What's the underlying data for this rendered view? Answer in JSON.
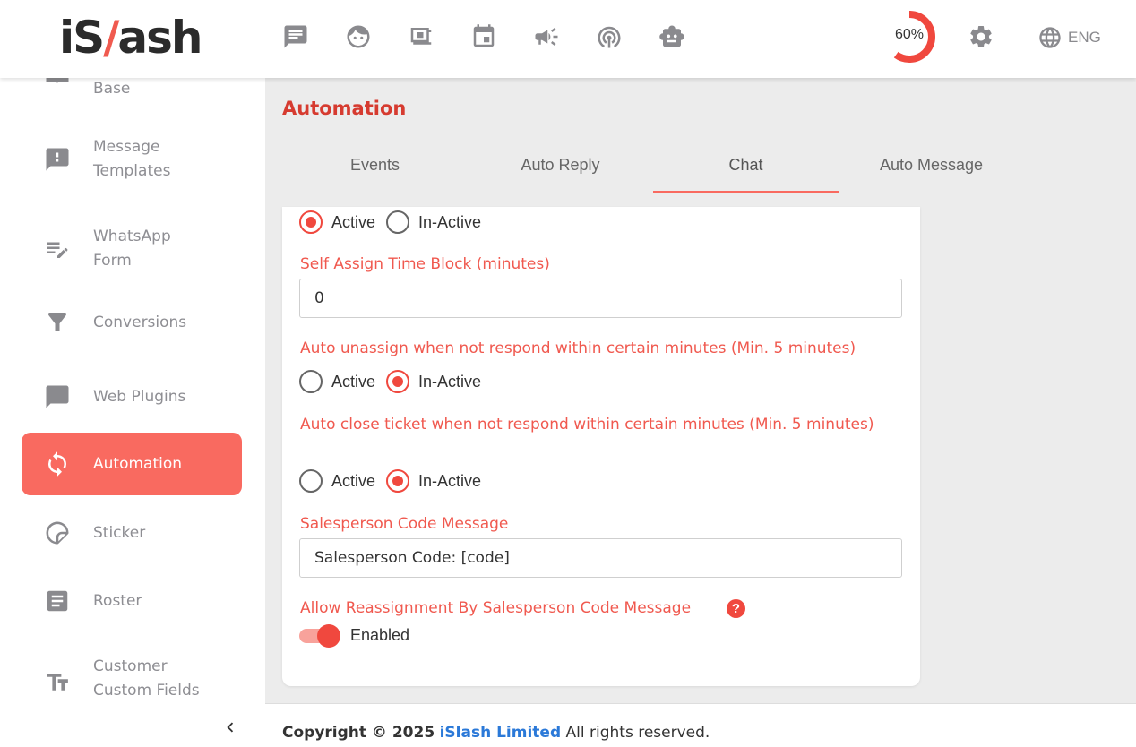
{
  "logo": {
    "text_left": "iS",
    "text_slash": "/",
    "text_right": "ash"
  },
  "topnav": {
    "icons": [
      "chat-icon",
      "face-icon",
      "video-icon",
      "calendar-icon",
      "megaphone-icon",
      "podcast-icon",
      "robot-icon"
    ],
    "progress": {
      "label": "60%",
      "value": 60,
      "color": "#f0483e"
    },
    "settings_icon": "gear-icon",
    "language": "ENG"
  },
  "sidebar": {
    "items": [
      {
        "label": "Base",
        "icon": "book-icon"
      },
      {
        "label": "Message\nTemplates",
        "icon": "alert-message-icon"
      },
      {
        "label": "WhatsApp\nForm",
        "icon": "form-edit-icon"
      },
      {
        "label": "Conversions",
        "icon": "funnel-icon"
      },
      {
        "label": "Web Plugins",
        "icon": "message-bubble-icon"
      },
      {
        "label": "Automation",
        "icon": "refresh-icon",
        "active": true
      },
      {
        "label": "Sticker",
        "icon": "sticker-icon"
      },
      {
        "label": "Roster",
        "icon": "list-icon"
      },
      {
        "label": "Customer\nCustom Fields",
        "icon": "text-fields-icon"
      }
    ]
  },
  "main": {
    "title": "Automation",
    "tabs": [
      {
        "label": "Events"
      },
      {
        "label": "Auto Reply"
      },
      {
        "label": "Chat",
        "active": true
      },
      {
        "label": "Auto Message"
      }
    ],
    "form": {
      "radio_active": "Active",
      "radio_inactive": "In-Active",
      "self_assign_label": "Self Assign Time Block (minutes)",
      "self_assign_value": "0",
      "auto_unassign_label": "Auto unassign when not respond within certain minutes (Min. 5 minutes)",
      "auto_close_label": "Auto close ticket when not respond within certain minutes (Min. 5 minutes)",
      "sales_code_label": "Salesperson Code Message",
      "sales_code_value": "Salesperson Code: [code]",
      "reassign_label": "Allow Reassignment By Salesperson Code Message",
      "help": "?",
      "toggle_label": "Enabled"
    }
  },
  "footer": {
    "prefix": "Copyright © 2025",
    "company": "iSlash Limited",
    "suffix": "All rights reserved."
  },
  "colors": {
    "accent": "#f96a60",
    "label": "#f0594f",
    "title": "#d63b30",
    "link": "#2b79d8"
  }
}
